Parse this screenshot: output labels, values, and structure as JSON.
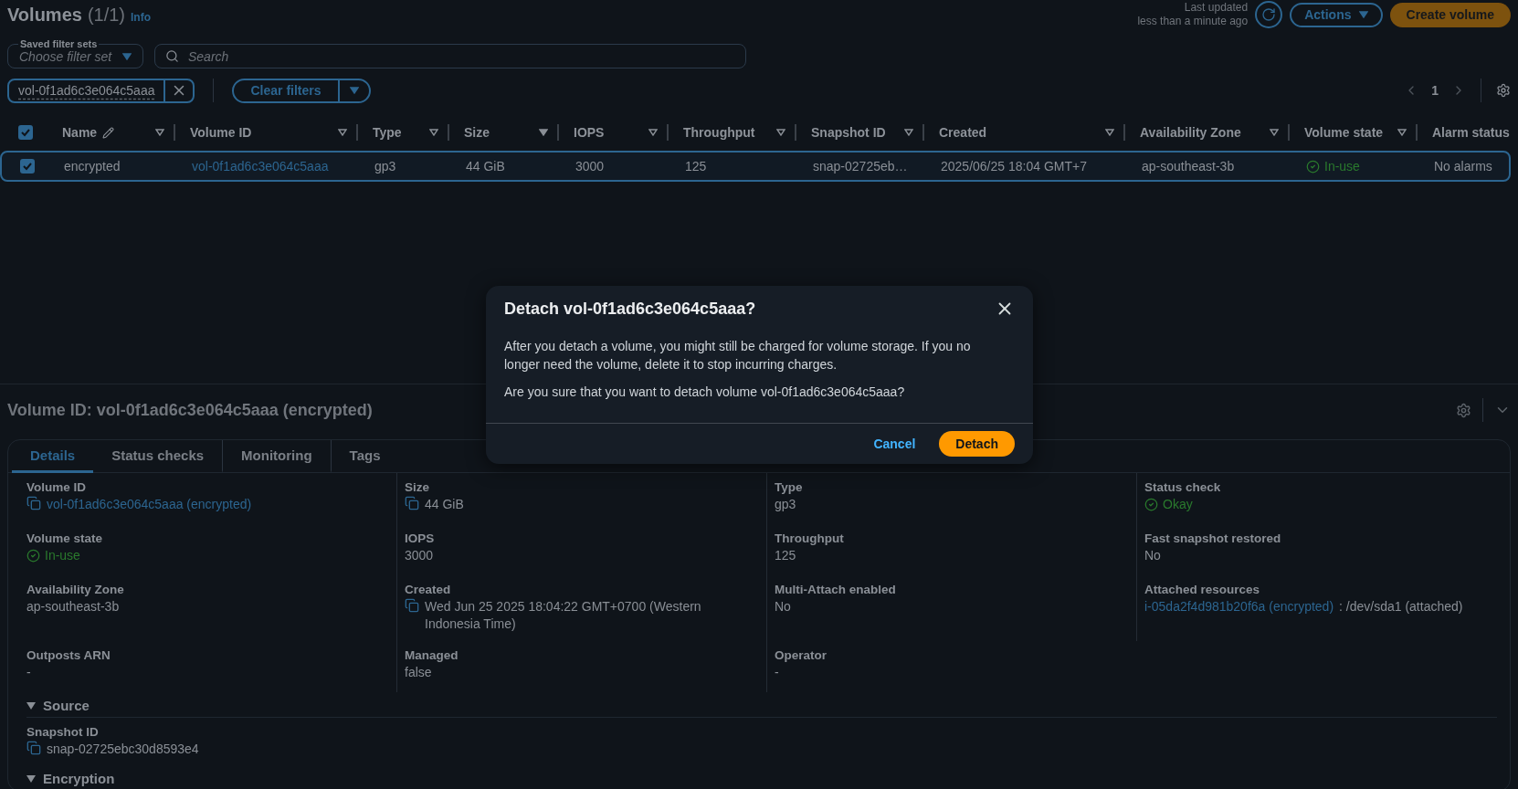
{
  "header": {
    "title": "Volumes",
    "count": "(1/1)",
    "info": "Info",
    "last_updated": [
      "Last updated",
      "less than a minute ago"
    ],
    "actions": "Actions",
    "create": "Create volume"
  },
  "filters": {
    "saved_label": "Saved filter sets",
    "saved_placeholder": "Choose filter set",
    "search_placeholder": "Search",
    "token": "vol-0f1ad6c3e064c5aaa",
    "clear": "Clear filters"
  },
  "pagination": {
    "page": "1"
  },
  "table": {
    "all_checked": true,
    "columns": [
      {
        "label": "Name",
        "editable": true,
        "sorted": false
      },
      {
        "label": "Volume ID",
        "editable": false,
        "sorted": false
      },
      {
        "label": "Type",
        "editable": false,
        "sorted": false
      },
      {
        "label": "Size",
        "editable": false,
        "sorted": true
      },
      {
        "label": "IOPS",
        "editable": false,
        "sorted": false
      },
      {
        "label": "Throughput",
        "editable": false,
        "sorted": false
      },
      {
        "label": "Snapshot ID",
        "editable": false,
        "sorted": false
      },
      {
        "label": "Created",
        "editable": false,
        "sorted": false
      },
      {
        "label": "Availability Zone",
        "editable": false,
        "sorted": false
      },
      {
        "label": "Volume state",
        "editable": false,
        "sorted": false
      },
      {
        "label": "Alarm status",
        "editable": false
      }
    ],
    "rows": [
      {
        "selected": true,
        "cells": [
          {
            "kind": "text",
            "text": "encrypted"
          },
          {
            "kind": "link",
            "text": "vol-0f1ad6c3e064c5aaa"
          },
          {
            "kind": "text",
            "text": "gp3"
          },
          {
            "kind": "text",
            "text": "44 GiB"
          },
          {
            "kind": "text",
            "text": "3000"
          },
          {
            "kind": "text",
            "text": "125"
          },
          {
            "kind": "text",
            "text": "snap-02725eb…"
          },
          {
            "kind": "text",
            "text": "2025/06/25 18:04 GMT+7"
          },
          {
            "kind": "text",
            "text": "ap-southeast-3b"
          },
          {
            "kind": "status",
            "text": "In-use"
          },
          {
            "kind": "text",
            "text": "No alarms"
          }
        ]
      }
    ]
  },
  "details": {
    "title": "Volume ID: vol-0f1ad6c3e064c5aaa (encrypted)",
    "tabs": [
      {
        "label": "Details",
        "selected": true
      },
      {
        "label": "Status checks",
        "selected": false
      },
      {
        "label": "Monitoring",
        "selected": false
      },
      {
        "label": "Tags",
        "selected": false
      }
    ],
    "fields": [
      {
        "label": "Volume ID",
        "kind": "copy_link",
        "value": "vol-0f1ad6c3e064c5aaa (encrypted)"
      },
      {
        "label": "Size",
        "kind": "copy_text",
        "value": "44 GiB"
      },
      {
        "label": "Type",
        "kind": "text",
        "value": "gp3"
      },
      {
        "label": "Status check",
        "kind": "status",
        "value": "Okay"
      },
      {
        "label": "Volume state",
        "kind": "status",
        "value": "In-use"
      },
      {
        "label": "IOPS",
        "kind": "text",
        "value": "3000"
      },
      {
        "label": "Throughput",
        "kind": "text",
        "value": "125"
      },
      {
        "label": "Fast snapshot restored",
        "kind": "text",
        "value": "No"
      },
      {
        "label": "Availability Zone",
        "kind": "text",
        "value": "ap-southeast-3b"
      },
      {
        "label": "Created",
        "kind": "copy_text",
        "value": "Wed Jun 25 2025 18:04:22 GMT+0700 (Western Indonesia Time)"
      },
      {
        "label": "Multi-Attach enabled",
        "kind": "text",
        "value": "No"
      },
      {
        "label": "Attached resources",
        "kind": "link_suffix",
        "value": "i-05da2f4d981b20f6a (encrypted)",
        "suffix": ": /dev/sda1 (attached)"
      },
      {
        "label": "Outposts ARN",
        "kind": "text",
        "value": "-"
      },
      {
        "label": "Managed",
        "kind": "text",
        "value": "false"
      },
      {
        "label": "Operator",
        "kind": "text",
        "value": "-"
      }
    ],
    "sections": [
      {
        "title": "Source",
        "expanded": true,
        "fields": [
          {
            "label": "Snapshot ID",
            "kind": "copy_text",
            "value": "snap-02725ebc30d8593e4"
          }
        ]
      },
      {
        "title": "Encryption",
        "expanded": true
      }
    ]
  },
  "modal": {
    "title": "Detach vol-0f1ad6c3e064c5aaa?",
    "paragraphs": [
      "After you detach a volume, you might still be charged for volume storage. If you no longer need the volume, delete it to stop incurring charges.",
      "Are you sure that you want to detach volume vol-0f1ad6c3e064c5aaa?"
    ],
    "cancel": "Cancel",
    "confirm": "Detach"
  }
}
